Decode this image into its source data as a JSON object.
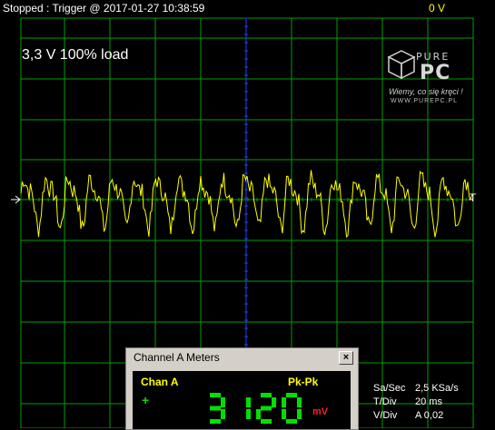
{
  "topbar": {
    "status_text": "Stopped : Trigger @ 2017-01-27 10:38:59",
    "trigger_level": "0 V"
  },
  "scope": {
    "title": "3,3 V 100% load",
    "trigger_marker": "T",
    "colors": {
      "grid": "#00a000",
      "trace": "#ffff00",
      "center_axis": "#2040ff",
      "background": "#000000"
    }
  },
  "logo": {
    "brand_top": "PURE",
    "brand_bottom": "PC",
    "slogan": "Wiemy, co się kręci !",
    "url": "WWW.PUREPC.PL"
  },
  "meter_window": {
    "title": "Channel A Meters",
    "close_label": "×",
    "channel": "Chan A",
    "measure_type": "Pk-Pk",
    "plus": "+",
    "value": "3120",
    "unit": "mV",
    "value_color": "#00e000"
  },
  "info": {
    "sample_rate_label": "Sa/Sec",
    "sample_rate_value": "2,5 KSa/s",
    "tdiv_label": "T/Div",
    "tdiv_value": "20 ms",
    "vdiv_label": "V/Div",
    "vdiv_value": "A 0,02"
  }
}
